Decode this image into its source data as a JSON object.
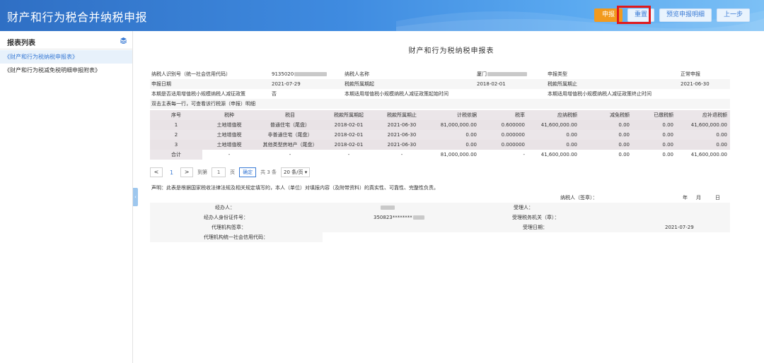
{
  "header": {
    "title": "财产和行为税合并纳税申报",
    "buttons": {
      "submit": "申报",
      "reset": "重置",
      "preview": "预览申报明细",
      "prev": "上一步"
    }
  },
  "sidebar": {
    "title": "报表列表",
    "items": [
      {
        "label": "《财产和行为税纳税申报表》"
      },
      {
        "label": "《财产和行为税减免税明细申报附表》"
      }
    ]
  },
  "form": {
    "title": "财产和行为税纳税申报表",
    "info": {
      "taxpayer_id_label": "纳税人识别号（统一社会信用代码）",
      "taxpayer_id_value": "9135020",
      "taxpayer_name_label": "纳税人名称",
      "taxpayer_name_value": "厦门",
      "declare_type_label": "申报类型",
      "declare_type_value": "正常申报",
      "declare_date_label": "申报日期",
      "declare_date_value": "2021-07-29",
      "period_start_label": "税款所属期起",
      "period_start_value": "2018-02-01",
      "period_end_label": "税款所属期止",
      "period_end_value": "2021-06-30",
      "small_policy_label": "本期是否适用增值税小规模纳税人减征政策",
      "small_policy_value": "否",
      "small_start_label": "本期适用增值税小规模纳税人减征政策起始时间",
      "small_end_label": "本期适用增值税小规模纳税人减征政策终止时间",
      "hint": "双击主表每一行，可查看该行税源（申报）明细"
    },
    "table": {
      "headers": [
        "序号",
        "税种",
        "税目",
        "税款所属期起",
        "税款所属期止",
        "计税依据",
        "税率",
        "应纳税额",
        "减免税额",
        "已缴税额",
        "应补退税额"
      ],
      "rows": [
        [
          "1",
          "土地增值税",
          "普通住宅（尾盘）",
          "2018-02-01",
          "2021-06-30",
          "81,000,000.00",
          "0.600000",
          "41,600,000.00",
          "0.00",
          "0.00",
          "41,600,000.00"
        ],
        [
          "2",
          "土地增值税",
          "非普通住宅（尾盘）",
          "2018-02-01",
          "2021-06-30",
          "0.00",
          "0.000000",
          "0.00",
          "0.00",
          "0.00",
          "0.00"
        ],
        [
          "3",
          "土地增值税",
          "其他类型房地产（尾盘）",
          "2018-02-01",
          "2021-06-30",
          "0.00",
          "0.000000",
          "0.00",
          "0.00",
          "0.00",
          "0.00"
        ]
      ],
      "footer": [
        "合计",
        "-",
        "-",
        "-",
        "-",
        "81,000,000.00",
        "-",
        "41,600,000.00",
        "0.00",
        "0.00",
        "41,600,000.00"
      ]
    },
    "pager": {
      "prev": "<",
      "page": "1",
      "next": ">",
      "goto_label": "到第",
      "input_value": "1",
      "page_unit": "页",
      "confirm": "确定",
      "total": "共 3 条",
      "per_page": "20 条/页"
    },
    "declaration": {
      "statement": "声明：此表是根据国家税收法律法规及相关规定填写的，本人（单位）对填报内容（及附带资料）的真实性、可靠性、完整性负责。",
      "signer_label": "纳税人（签章）：",
      "year": "年",
      "month": "月",
      "day": "日",
      "agent_label": "经办人：",
      "receiver_label": "受理人：",
      "agent_id_label": "经办人身份证件号：",
      "agent_id_value": "350823********",
      "tax_office_label": "受理税务机关（章）：",
      "agency_sign_label": "代理机构签章：",
      "accept_date_label": "受理日期：",
      "accept_date_value": "2021-07-29",
      "agency_code_label": "代理机构统一社会信用代码："
    }
  },
  "colors": {
    "header_blue": "#3f8be0",
    "primary_orange": "#f29a1e",
    "highlight_red": "#e1191c",
    "link_blue": "#3a7bd5"
  }
}
